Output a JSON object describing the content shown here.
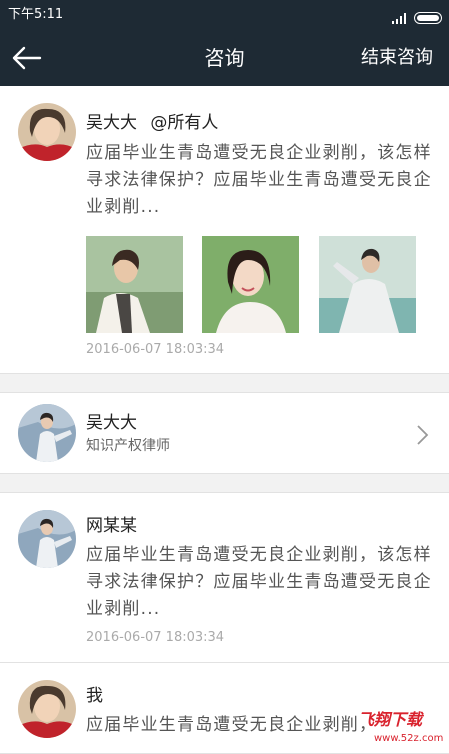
{
  "status_bar": {
    "time": "下午5:11"
  },
  "nav": {
    "title": "咨询",
    "end_label": "结束咨询"
  },
  "question": {
    "author": "吴大大",
    "mention": "@所有人",
    "body": "应届毕业生青岛遭受无良企业剥削，该怎样寻求法律保护？应届毕业生青岛遭受无良企业剥削...",
    "time": "2016-06-07 18:03:34"
  },
  "lawyer": {
    "name": "吴大大",
    "title": "知识产权律师"
  },
  "messages": [
    {
      "name": "网某某",
      "body": "应届毕业生青岛遭受无良企业剥削，该怎样寻求法律保护？应届毕业生青岛遭受无良企业剥削...",
      "time": "2016-06-07 18:03:34"
    },
    {
      "name": "我",
      "body": "应届毕业生青岛遭受无良企业剥削，"
    }
  ],
  "watermark": {
    "brand": "飞翔下载",
    "url": "www.52z.com"
  },
  "colors": {
    "nav_bg": "#1e2a34",
    "page_bg": "#f2f2f2",
    "muted_text": "#aaaaaa",
    "watermark": "#d9232e"
  }
}
